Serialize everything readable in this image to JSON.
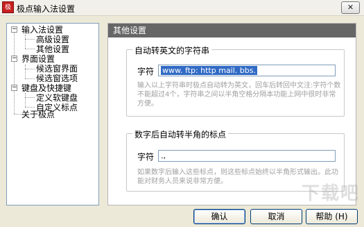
{
  "window": {
    "title": "极点输入法设置",
    "app_icon_text": "极",
    "close_glyph": "✕"
  },
  "tree": {
    "collapse_glyph": "−",
    "groups": [
      {
        "label": "输入法设置",
        "children": [
          "高级设置",
          "其他设置"
        ]
      },
      {
        "label": "界面设置",
        "children": [
          "候选窗界面",
          "候选窗选项"
        ]
      },
      {
        "label": "键盘及快捷键",
        "children": [
          "定义软键盘",
          "自定义标点"
        ]
      }
    ],
    "extra": "关于极点"
  },
  "panel": {
    "header": "其他设置",
    "group1": {
      "title": "自动转英文的字符串",
      "field_label": "字符",
      "value": "www. ftp: http mail. bbs.",
      "desc": "输入以上字符串时极点自动转为英文，回车后转回中文注:字符个数不能超过4个，字符串之间以半角空格分隔本功能上网中很时非常方便。"
    },
    "group2": {
      "title": "数字后自动转半角的标点",
      "field_label": "字符",
      "value": ".,",
      "desc": "如果数字后输入这些标点，则这些标点始终以半角形式输出。此功能对财务人员来说非常方便。"
    }
  },
  "buttons": {
    "ok": "确认",
    "cancel": "取消",
    "help": "帮助 (H)"
  },
  "watermark": "下载吧"
}
